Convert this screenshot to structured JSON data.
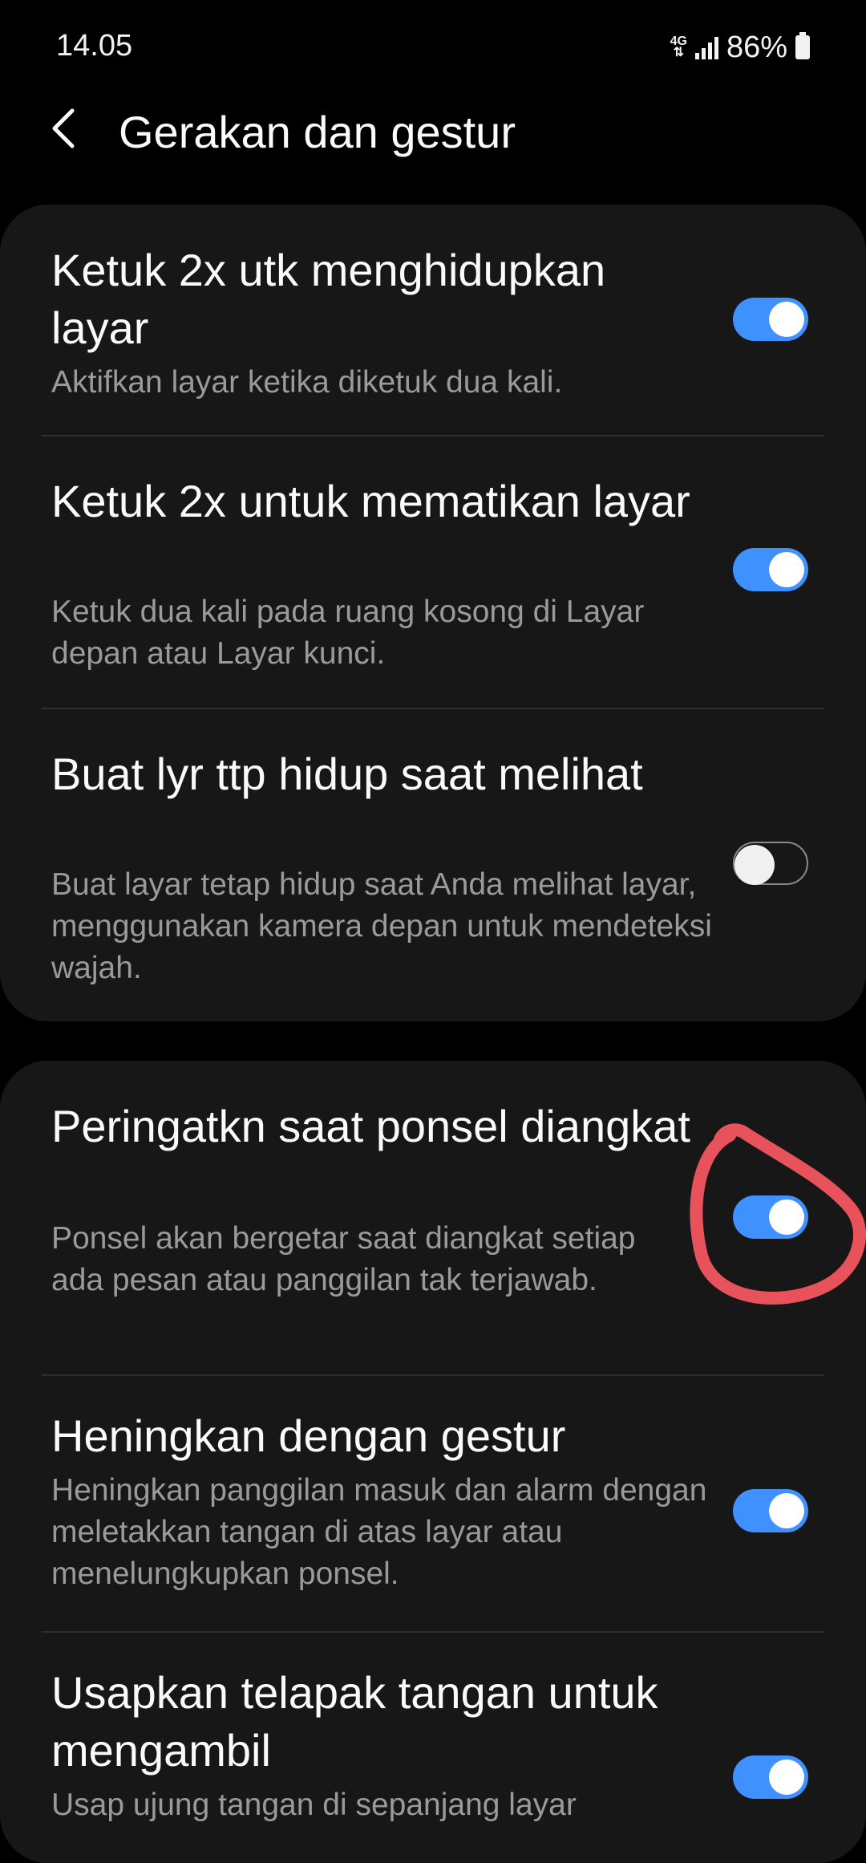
{
  "status_bar": {
    "time": "14.05",
    "network": "4G",
    "battery": "86%"
  },
  "header": {
    "title": "Gerakan dan gestur",
    "back_icon": "chevron-left-icon"
  },
  "settings": [
    {
      "title": "Ketuk 2x utk menghidupkan layar",
      "desc": "Aktifkan layar ketika diketuk dua kali.",
      "enabled": true
    },
    {
      "title": "Ketuk 2x untuk mematikan layar",
      "desc": "Ketuk dua kali pada ruang kosong di Layar depan atau Layar kunci.",
      "enabled": true
    },
    {
      "title": "Buat lyr ttp hidup saat melihat",
      "desc": "Buat layar tetap hidup saat Anda melihat layar, menggunakan kamera depan untuk mendeteksi wajah.",
      "enabled": false
    },
    {
      "title": "Peringatkn saat ponsel diangkat",
      "desc": "Ponsel akan bergetar saat diangkat setiap ada pesan atau panggilan tak terjawab.",
      "enabled": true
    },
    {
      "title": "Heningkan dengan gestur",
      "desc": "Heningkan panggilan masuk dan alarm dengan meletakkan tangan di atas layar atau menelungkupkan ponsel.",
      "enabled": true
    },
    {
      "title": "Usapkan telapak tangan untuk mengambil",
      "desc": "Usap ujung tangan di sepanjang layar",
      "enabled": true
    }
  ],
  "colors": {
    "accent": "#3e91ff",
    "background": "#000000",
    "card": "#171717",
    "annotation": "#e8525a"
  }
}
